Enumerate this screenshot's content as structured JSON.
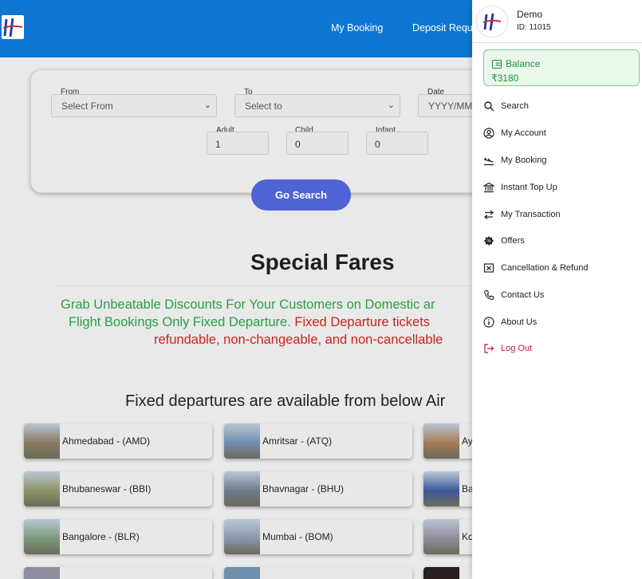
{
  "header": {
    "nav": [
      "My Booking",
      "Deposit Reque"
    ]
  },
  "search_form": {
    "from_label": "From",
    "from_placeholder": "Select From",
    "to_label": "To",
    "to_placeholder": "Select to",
    "date_label": "Date",
    "date_placeholder": "YYYY/MM/",
    "adult_label": "Adult",
    "adult_value": "1",
    "child_label": "Child",
    "child_value": "0",
    "infant_label": "Infant",
    "infant_value": "0",
    "search_button": "Go Search"
  },
  "special_fares": {
    "title": "Special Fares",
    "line1": "Grab Unbeatable Discounts For Your Customers on Domestic ar",
    "line2_green": "Flight Bookings Only Fixed Departure.",
    "line2_red": "Fixed Departure tickets",
    "line3_red": "refundable, non-changeable, and non-cancellable"
  },
  "fixed_departures": {
    "heading": "Fixed departures are available from below Air",
    "airports": [
      {
        "name": "Ahmedabad - (AMD)",
        "thumb": "#8a7a62"
      },
      {
        "name": "Amritsar - (ATQ)",
        "thumb": "#6f8fae"
      },
      {
        "name": "Ay",
        "thumb": "#a57a55"
      },
      {
        "name": "Bhubaneswar - (BBI)",
        "thumb": "#8b9468"
      },
      {
        "name": "Bhavnagar - (BHU)",
        "thumb": "#6e7a8c"
      },
      {
        "name": "Ba",
        "thumb": "#3d5a9a"
      },
      {
        "name": "Bangalore - (BLR)",
        "thumb": "#7a9a7a"
      },
      {
        "name": "Mumbai - (BOM)",
        "thumb": "#8a95aa"
      },
      {
        "name": "Ko",
        "thumb": "#8f8d9a"
      }
    ]
  },
  "drawer": {
    "user_name": "Demo",
    "user_id": "ID: 11015",
    "balance_label": "Balance",
    "balance_value": "₹3180",
    "menu": [
      {
        "label": "Search",
        "icon": "search-icon"
      },
      {
        "label": "My Account",
        "icon": "user-circle-icon"
      },
      {
        "label": "My Booking",
        "icon": "plane-icon"
      },
      {
        "label": "Instant Top Up",
        "icon": "bank-icon"
      },
      {
        "label": "My Transaction",
        "icon": "transfer-arrows-icon"
      },
      {
        "label": "Offers",
        "icon": "badge-icon"
      },
      {
        "label": "Cancellation & Refund",
        "icon": "cancel-box-icon"
      },
      {
        "label": "Contact Us",
        "icon": "phone-icon"
      },
      {
        "label": "About Us",
        "icon": "info-icon"
      },
      {
        "label": "Log Out",
        "icon": "logout-icon"
      }
    ]
  },
  "colors": {
    "header_blue": "#0d76d3",
    "button_blue": "#4f63d4",
    "promo_green": "#27a045",
    "promo_red": "#c8261b",
    "logout_red": "#c0163a"
  }
}
